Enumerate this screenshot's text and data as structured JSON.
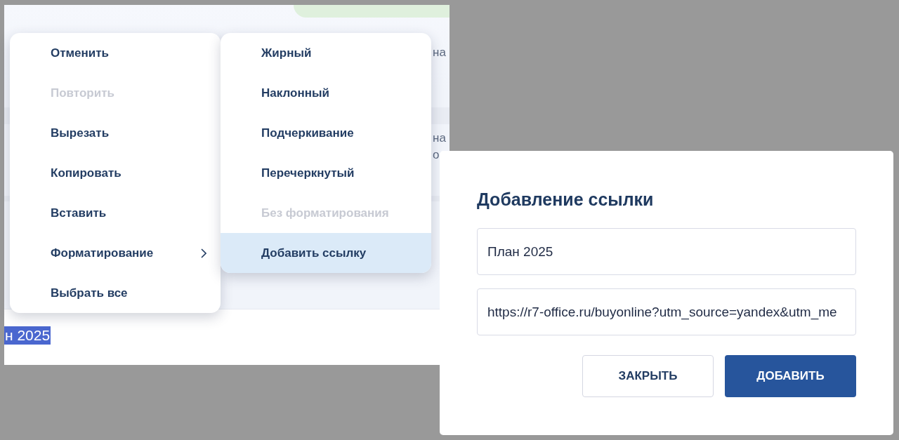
{
  "background_page": {
    "fragments": [
      "на",
      "на",
      "о"
    ],
    "selected_text": "н 2025"
  },
  "context_menu": {
    "items": [
      {
        "label": "Отменить",
        "disabled": false,
        "selected": false,
        "kind": "action"
      },
      {
        "label": "Повторить",
        "disabled": true,
        "selected": false,
        "kind": "action"
      },
      {
        "label": "Вырезать",
        "disabled": false,
        "selected": false,
        "kind": "action"
      },
      {
        "label": "Копировать",
        "disabled": false,
        "selected": false,
        "kind": "action"
      },
      {
        "label": "Вставить",
        "disabled": false,
        "selected": false,
        "kind": "action"
      },
      {
        "label": "Форматирование",
        "disabled": false,
        "selected": false,
        "kind": "submenu"
      },
      {
        "label": "Выбрать все",
        "disabled": false,
        "selected": false,
        "kind": "action"
      }
    ]
  },
  "submenu": {
    "items": [
      {
        "label": "Жирный",
        "disabled": false,
        "selected": false
      },
      {
        "label": "Наклонный",
        "disabled": false,
        "selected": false
      },
      {
        "label": "Подчеркивание",
        "disabled": false,
        "selected": false
      },
      {
        "label": "Перечеркнутый",
        "disabled": false,
        "selected": false
      },
      {
        "label": "Без форматирования",
        "disabled": true,
        "selected": false
      },
      {
        "label": "Добавить ссылку",
        "disabled": false,
        "selected": true
      }
    ]
  },
  "dialog": {
    "title": "Добавление ссылки",
    "text_field": {
      "value": "План 2025"
    },
    "url_field": {
      "value": "https://r7-office.ru/buyonline?utm_source=yandex&utm_me"
    },
    "buttons": [
      {
        "label": "ЗАКРЫТЬ",
        "kind": "secondary"
      },
      {
        "label": "ДОБАВИТЬ",
        "kind": "primary"
      }
    ]
  }
}
